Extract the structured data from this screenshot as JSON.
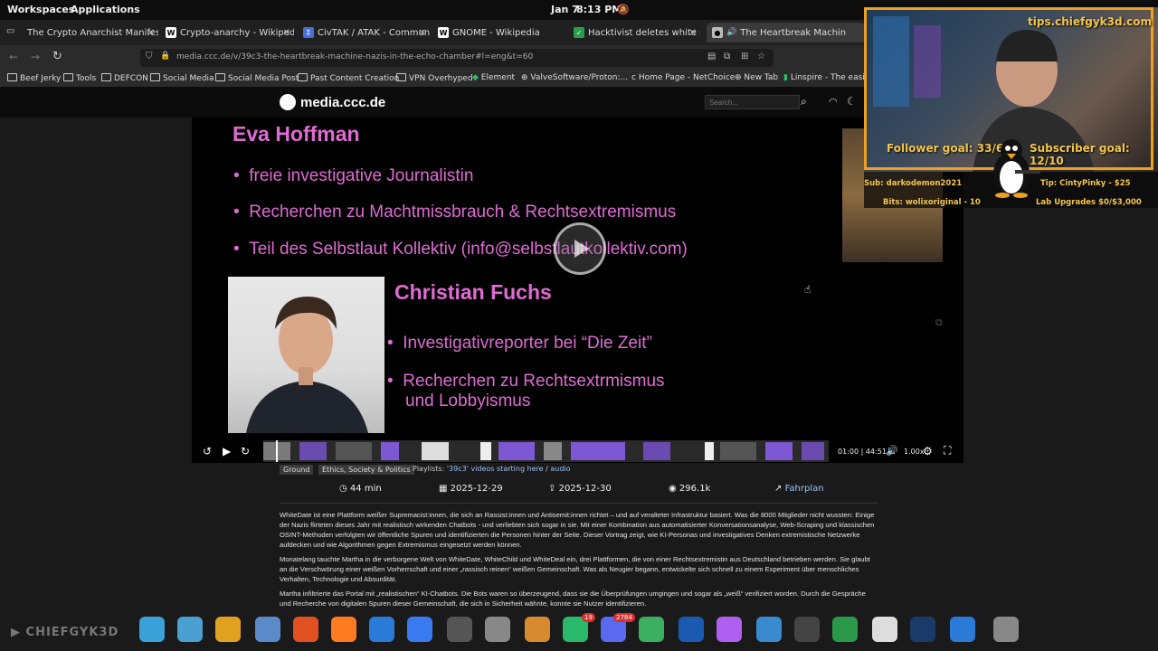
{
  "top_panel": {
    "workspaces": "Workspaces",
    "applications": "Applications",
    "date": "Jan 7",
    "time": "8:13 PM"
  },
  "tabs": [
    {
      "title": "The Crypto Anarchist Manifesto",
      "active": false
    },
    {
      "title": "Crypto-anarchy - Wikipedia",
      "active": false
    },
    {
      "title": "CivTAK / ATAK - Commun",
      "active": false
    },
    {
      "title": "GNOME - Wikipedia",
      "active": false
    },
    {
      "title": "Hacktivist deletes white sup",
      "active": false
    },
    {
      "title": "The Heartbreak Machin",
      "active": true
    }
  ],
  "url": "media.ccc.de/v/39c3-the-heartbreak-machine-nazis-in-the-echo-chamber#l=eng&t=60",
  "bookmarks": [
    "Beef Jerky",
    "Tools",
    "DEFCON",
    "Social Media",
    "Social Media Post",
    "Past Content Creation",
    "VPN Overhyped",
    "Element",
    "ValveSoftware/Proton:...",
    "Home Page - NetChoice",
    "New Tab",
    "Linspire - The easi"
  ],
  "site": {
    "logo": "media.ccc.de",
    "search_placeholder": "Search..."
  },
  "slide": {
    "person1": "Eva Hoffman",
    "person1_points": [
      "freie investigative Journalistin",
      "Recherchen zu Machtmissbrauch & Rechtsextremismus",
      "Teil des Selbstlaut Kollektiv (info@selbstlautkollektiv.com)"
    ],
    "person2": "Christian Fuchs",
    "person2_points": [
      "Investigativreporter bei “Die Zeit”",
      "Recherchen zu Rechtsextrmismus",
      "und Lobbyismus"
    ],
    "accent": "#e06bd4"
  },
  "player": {
    "timecode": "01:00 | 44:51",
    "speed": "1.00x",
    "progress": 0.022
  },
  "meta": {
    "tags": [
      "Ground",
      "Ethics, Society & Politics"
    ],
    "playlists_label": "Playlists:",
    "playlist_link": "'39c3' videos starting here",
    "playlist_sep": " / ",
    "audio_link": "audio",
    "duration": "44 min",
    "date": "2025-12-29",
    "release": "2025-12-30",
    "views": "296.1k",
    "fahrplan": "Fahrplan"
  },
  "description": [
    "WhiteDate ist eine Plattform weißer Supremacist:innen, die sich an Rassist:innen und Antisemit:innen richtet – und auf veralteter Infrastruktur basiert. Was die 8000 Mitglieder nicht wussten: Einige der Nazis flirteten dieses Jahr mit realistisch wirkenden Chatbots - und verliebten sich sogar in sie. Mit einer Kombination aus automatisierter Konversationsanalyse, Web-Scraping und klassischen OSINT-Methoden verfolgten wir öffentliche Spuren und identifizierten die Personen hinter der Seite. Dieser Vortrag zeigt, wie KI-Personas und investigatives Denken extremistische Netzwerke aufdecken und wie Algorithmen gegen Extremismus eingesetzt werden können.",
    "Monatelang tauchte Martha in die verborgene Welt von WhiteDate, WhiteChild und WhiteDeal ein, drei Plattformen, die von einer Rechtsextremistin aus Deutschland betrieben werden. Sie glaubt an die Verschwörung einer weißen Vorherrschaft und einer „rassisch reinen“ weißen Gemeinschaft. Was als Neugier begann, entwickelte sich schnell zu einem Experiment über menschliches Verhalten, Technologie und Absurdität.",
    "Martha infiltrierte das Portal mit „realistischen“ KI-Chatbots. Die Bots waren so überzeugend, dass sie die Überprüfungen umgingen und sogar als „weiß“ verifiziert worden. Durch die Gespräche und Recherche von digitalen Spuren dieser Gemeinschaft, die sich in Sicherheit wähnte, konnte sie Nutzer identifizieren."
  ],
  "overlay": {
    "tip_url": "tips.chiefgyk3d.com",
    "follower_goal": "Follower goal: 33/60",
    "subscriber_goal": "Subscriber goal: 12/10",
    "sub": "Sub: darkodemon2021",
    "tip": "Tip: CintyPinky - $25",
    "bits": "Bits: wolixoriginal - 10",
    "lab": "Lab Upgrades $0/$3,000",
    "frame_color": "#f0a020",
    "text_color": "#f3c54a"
  },
  "dock": {
    "brand": "CHIEFGYK3D",
    "badge1": "19",
    "badge2": "2784"
  }
}
